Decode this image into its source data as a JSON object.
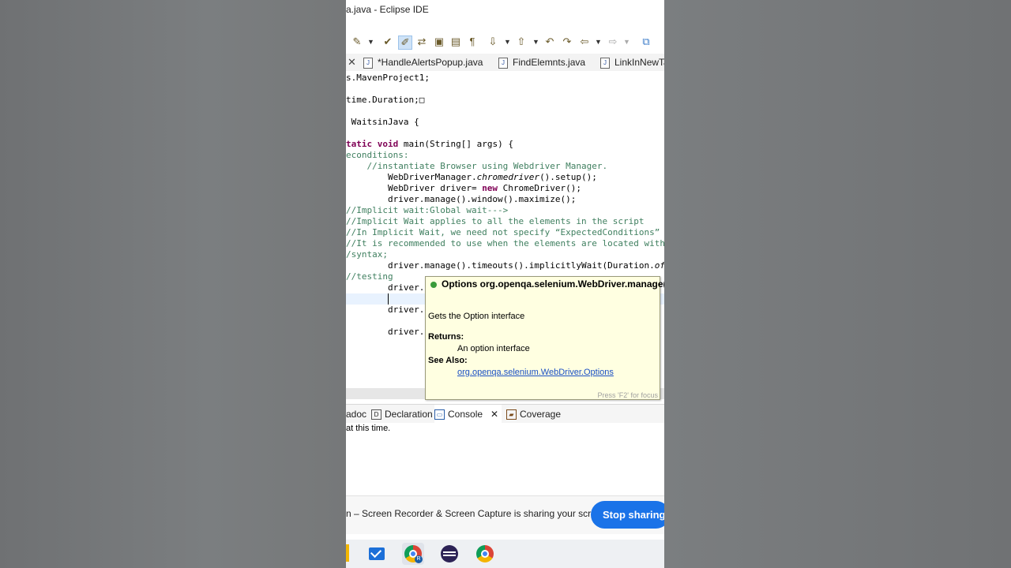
{
  "window": {
    "title": "a.java - Eclipse IDE"
  },
  "editor_tabs": [
    {
      "label": "*HandleAlertsPopup.java"
    },
    {
      "label": "FindElemnts.java"
    },
    {
      "label": "LinkInNewTa"
    }
  ],
  "code_lines": [
    {
      "text": "s.MavenProject1;"
    },
    {
      "text": "time.Duration;□"
    },
    {
      "pre": " ",
      "kw": "",
      "text": "WaitsinJava {"
    },
    {
      "kw1": "tatic",
      "kw2": "void",
      "text": " main(String[] args) {"
    },
    {
      "text": "econditions:"
    },
    {
      "text": "    //instantiate Browser using Webdriver Manager."
    },
    {
      "text": "        WebDriverManager.",
      "it": "chromedriver",
      "rest": "().setup();"
    },
    {
      "text": "        WebDriver driver= ",
      "kw": "new",
      "rest": " ChromeDriver();"
    },
    {
      "text": "        driver.manage().window().maximize();"
    },
    {
      "text": "//Implicit wait:Global wait--->"
    },
    {
      "text": "//Implicit Wait applies to all the elements in the script"
    },
    {
      "text": "//In Implicit Wait, we need not specify “ExpectedConditions” o"
    },
    {
      "text": "//It is recommended to use when the elements are located with"
    },
    {
      "text": "/syntax;"
    },
    {
      "text": "        driver.manage().timeouts().implicitlyWait(Duration.",
      "it": "of"
    },
    {
      "text": "//testing"
    },
    {
      "text": "        driver."
    },
    {
      "text": "        driver."
    },
    {
      "text": "        driver."
    }
  ],
  "tooltip": {
    "title": "Options org.openqa.selenium.WebDriver.manage()",
    "description": "Gets the Option interface",
    "returns_label": "Returns:",
    "returns_text": "An option interface",
    "see_also_label": "See Also:",
    "see_also_link": "org.openqa.selenium.WebDriver.Options",
    "footer": "Press 'F2' for focus"
  },
  "bottom_tabs": [
    {
      "label": "adoc"
    },
    {
      "label": "Declaration"
    },
    {
      "label": "Console"
    },
    {
      "label": "Coverage"
    }
  ],
  "console": {
    "text": "at this time."
  },
  "share_bar": {
    "text": "n – Screen Recorder & Screen Capture is sharing your screen.",
    "stop_label": "Stop sharing"
  },
  "taskbar": {
    "badge": "R"
  }
}
